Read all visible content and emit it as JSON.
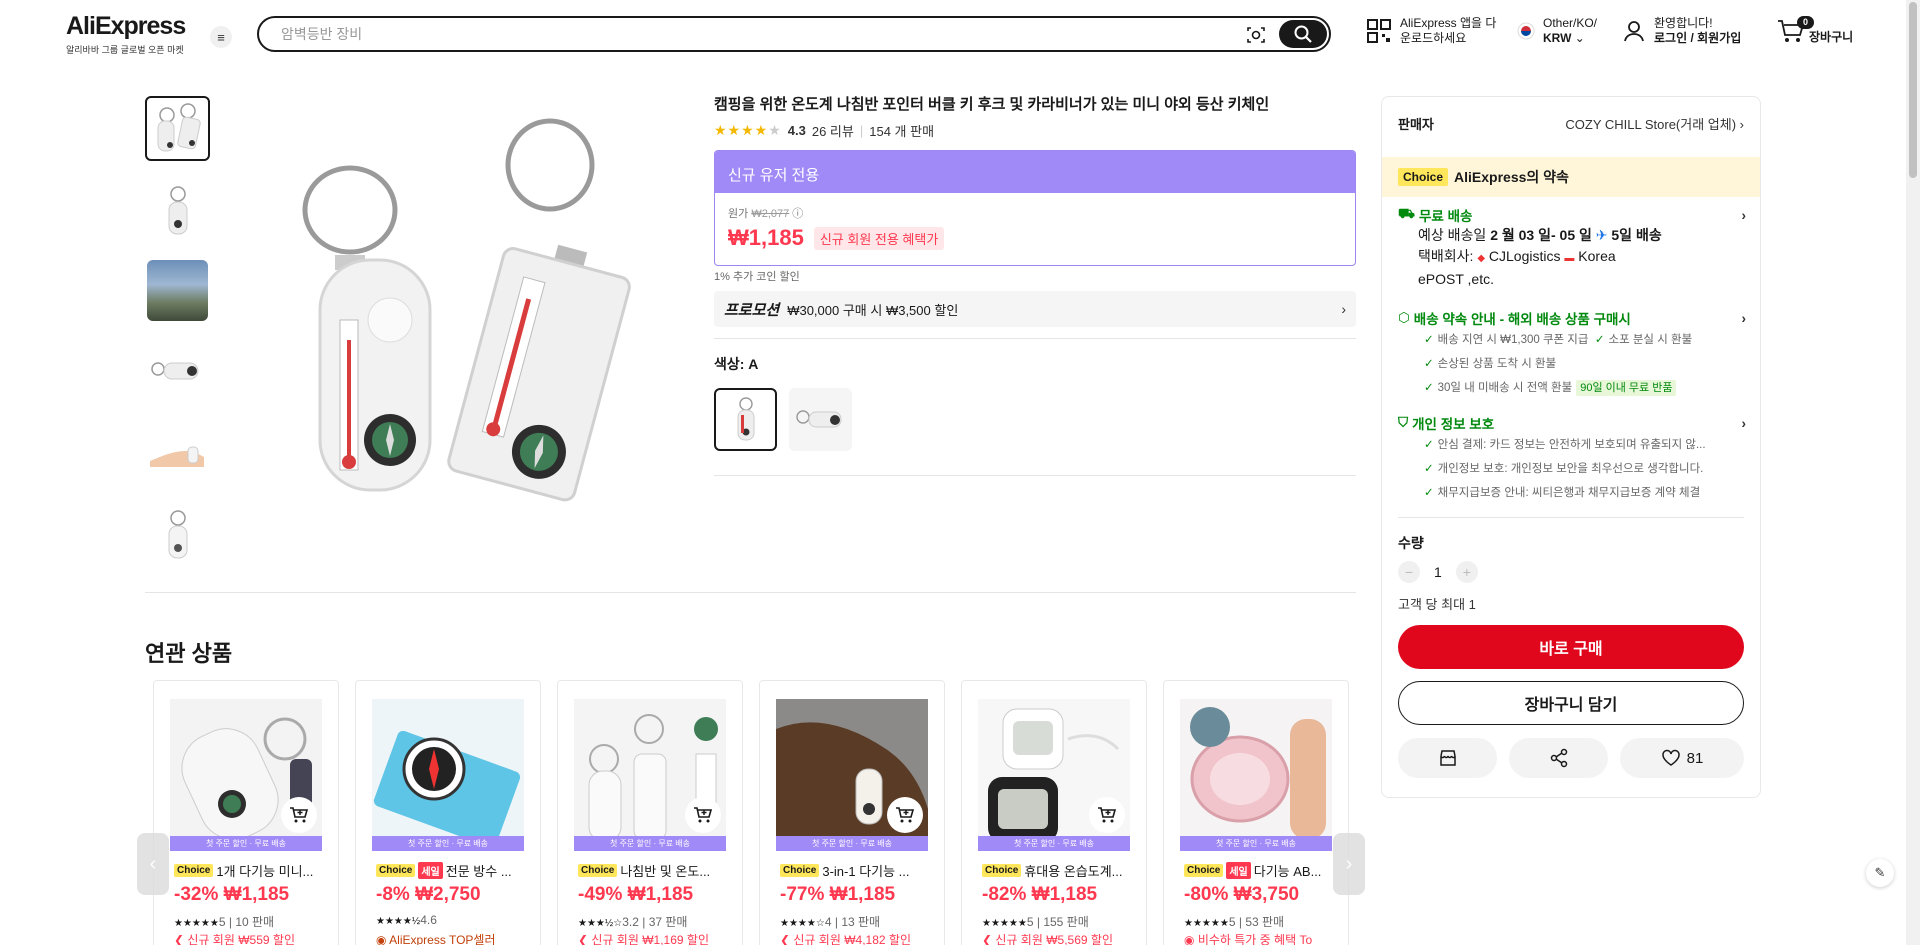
{
  "header": {
    "logo": "AliExpress",
    "logo_sub": "알리바바 그룹 글로벌 오픈 마켓",
    "search_placeholder": "암벽등반 장비",
    "app_line1": "AliExpress 앱을 다",
    "app_line2": "운로드하세요",
    "region_line1": "Other/KO/",
    "region_line2": "KRW",
    "account_line1": "환영합니다!",
    "account_line2": "로그인 / 회원가입",
    "cart_count": "0",
    "cart_label": "장바구니"
  },
  "product": {
    "title": "캠핑을 위한 온도계 나침반 포인터 버클 키 후크 및 카라비너가 있는 미니 야외 등산 키체인",
    "rating": "4.3",
    "reviews": "26 리뷰",
    "sold": "154 개 판매",
    "new_user_header": "신규 유저 전용",
    "original_label": "원가",
    "original_price": "₩2,077",
    "price": "₩1,185",
    "new_user_tag": "신규 회원 전용 혜택가",
    "coin_note": "1% 추가 코인 할인",
    "promo_label": "프로모션",
    "promo_text": "₩30,000 구매 시 ₩3,500 할인",
    "color_label": "색상: A"
  },
  "related": {
    "title": "연관 상품",
    "strip_text": "첫 주문 할인 · 무료 배송",
    "items": [
      {
        "badge_choice": "Choice",
        "badge_sale": "",
        "name": "1개 다기능 미니...",
        "price": "-32% ₩1,185",
        "stars": "★★★★★",
        "rating": "5",
        "sold": "10 판매",
        "coupon": "신규 회원 ₩559 할인"
      },
      {
        "badge_choice": "Choice",
        "badge_sale": "세일",
        "name": "전문 방수 ...",
        "price": "-8% ₩2,750",
        "stars": "★★★★½",
        "rating": "4.6",
        "sold": "",
        "coupon": "AliExpress TOP셀러"
      },
      {
        "badge_choice": "Choice",
        "badge_sale": "",
        "name": "나침반 및 온도...",
        "price": "-49% ₩1,185",
        "stars": "★★★½☆",
        "rating": "3.2",
        "sold": "37 판매",
        "coupon": "신규 회원 ₩1,169 할인"
      },
      {
        "badge_choice": "Choice",
        "badge_sale": "",
        "name": "3-in-1 다기능 ...",
        "price": "-77% ₩1,185",
        "stars": "★★★★☆",
        "rating": "4",
        "sold": "13 판매",
        "coupon": "신규 회원 ₩4,182 할인"
      },
      {
        "badge_choice": "Choice",
        "badge_sale": "",
        "name": "휴대용 온습도계...",
        "price": "-82% ₩1,185",
        "stars": "★★★★★",
        "rating": "5",
        "sold": "155 판매",
        "coupon": "신규 회원 ₩5,569 할인"
      },
      {
        "badge_choice": "Choice",
        "badge_sale": "세일",
        "name": "다기능 AB...",
        "price": "-80% ₩3,750",
        "stars": "★★★★★",
        "rating": "5",
        "sold": "53 판매",
        "coupon": "비수하 특가 중 혜택 To"
      }
    ]
  },
  "panel": {
    "seller_label": "판매자",
    "seller_name": "COZY CHILL Store(거래 업체)",
    "choice_badge": "Choice",
    "promise_text": "AliExpress의 약속",
    "free_shipping": "무료 배송",
    "est_label": "예상 배송일",
    "est_dates": "2 월 03 일- 05 일",
    "est_days": "5일 배송",
    "carrier_label": "택배회사:",
    "carrier_1": "CJLogistics",
    "carrier_2": "Korea",
    "carrier_3": "ePOST ,etc.",
    "guarantee_title": "배송 약속 안내 - 해외 배송 상품 구매시",
    "guarantee_1": "배송 지연 시 ₩1,300 쿠폰 지급",
    "guarantee_2": "소포 분실 시 환불",
    "guarantee_3": "손상된 상품 도착 시 환불",
    "guarantee_4": "30일 내 미배송 시 전액 환불",
    "guarantee_tag": "90일 이내 무료 반품",
    "privacy_title": "개인 정보 보호",
    "privacy_1": "안심 결제: 카드 정보는 안전하게 보호되며 유출되지 않...",
    "privacy_2": "개인정보 보호: 개인정보 보안을 최우선으로 생각합니다.",
    "privacy_3": "채무지급보증 안내: 씨티은행과 채무지급보증 계약 체결",
    "qty_label": "수량",
    "qty_value": "1",
    "max_note": "고객 당 최대 1",
    "buy_now": "바로 구매",
    "add_to_cart": "장바구니 담기",
    "wish_count": "81"
  },
  "colors": {
    "accent_red": "#e0071d",
    "price_red": "#fd384f",
    "purple": "#a08af7",
    "green": "#028a0f"
  },
  "icons": [
    "menu-icon",
    "camera-search-icon",
    "search-icon",
    "qr-icon",
    "korea-flag-icon",
    "user-icon",
    "cart-icon",
    "truck-icon",
    "shield-icon",
    "store-icon",
    "share-icon",
    "heart-icon",
    "edit-icon"
  ]
}
